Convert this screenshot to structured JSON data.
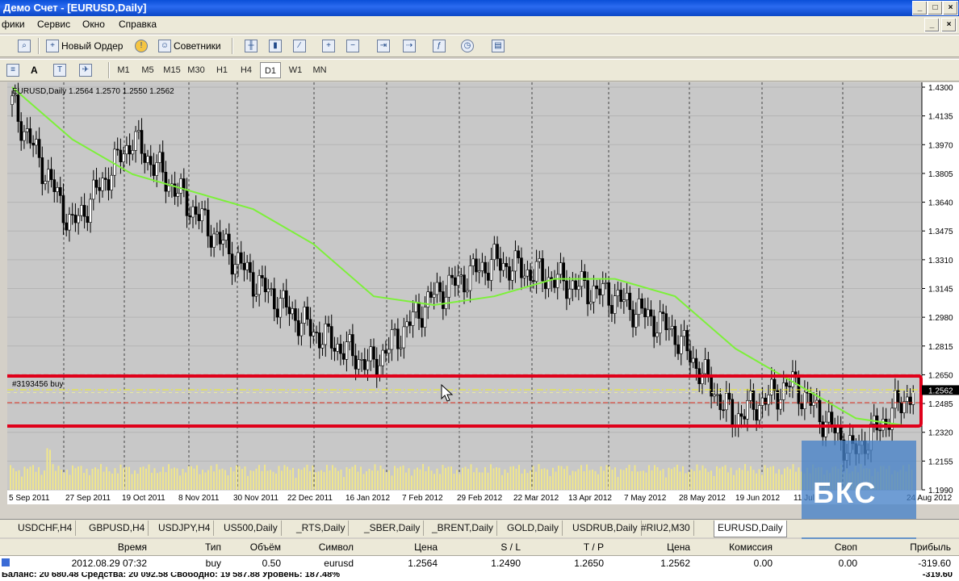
{
  "window": {
    "title": "Демо Счет - [EURUSD,Daily]"
  },
  "menu": [
    "фики",
    "Сервис",
    "Окно",
    "Справка"
  ],
  "toolbar": {
    "new_order": "Новый Ордер",
    "advisors": "Советники"
  },
  "timeframes": [
    "M1",
    "M5",
    "M15",
    "M30",
    "H1",
    "H4",
    "D1",
    "W1",
    "MN"
  ],
  "active_timeframe": "D1",
  "chart": {
    "info": "EURUSD,Daily  1.2564 1.2570 1.2550 1.2562",
    "order_label": "#3193456 buy",
    "price_labels": [
      "1.4300",
      "1.4135",
      "1.3970",
      "1.3805",
      "1.3640",
      "1.3475",
      "1.3310",
      "1.3145",
      "1.2980",
      "1.2815",
      "1.2650",
      "1.2485",
      "1.2320",
      "1.2155",
      "1.1990"
    ],
    "current_price": "1.2562",
    "date_labels": [
      "5 Sep 2011",
      "27 Sep 2011",
      "19 Oct 2011",
      "8 Nov 2011",
      "30 Nov 2011",
      "22 Dec 2011",
      "16 Jan 2012",
      "7 Feb 2012",
      "29 Feb 2012",
      "22 Mar 2012",
      "13 Apr 2012",
      "7 May 2012",
      "28 May 2012",
      "19 Jun 2012",
      "11 Jul",
      "24 Aug 2012"
    ],
    "colors": {
      "background": "#c8c8c8",
      "up_candle": "#ffffff",
      "moving_average": "#7df03a",
      "highlight_box": "#e0001a",
      "volume": "#f0e68c"
    }
  },
  "chart_data": {
    "type": "candlestick",
    "symbol": "EURUSD",
    "timeframe": "Daily",
    "last_bar": {
      "open": 1.2564,
      "high": 1.257,
      "low": 1.255,
      "close": 1.2562
    },
    "ylim": [
      1.199,
      1.43
    ],
    "x": [
      "5 Sep 2011",
      "27 Sep 2011",
      "19 Oct 2011",
      "8 Nov 2011",
      "30 Nov 2011",
      "22 Dec 2011",
      "16 Jan 2012",
      "7 Feb 2012",
      "29 Feb 2012",
      "22 Mar 2012",
      "13 Apr 2012",
      "7 May 2012",
      "28 May 2012",
      "19 Jun 2012",
      "11 Jul",
      "24 Aug 2012"
    ],
    "close": [
      1.42,
      1.35,
      1.4,
      1.36,
      1.32,
      1.29,
      1.27,
      1.31,
      1.33,
      1.32,
      1.31,
      1.29,
      1.24,
      1.26,
      1.22,
      1.256
    ],
    "moving_average": [
      1.43,
      1.4,
      1.38,
      1.37,
      1.36,
      1.34,
      1.31,
      1.305,
      1.31,
      1.32,
      1.32,
      1.31,
      1.28,
      1.26,
      1.24,
      1.235
    ]
  },
  "tabs": [
    "USDCHF,H4",
    "GBPUSD,H4",
    "USDJPY,H4",
    "US500,Daily",
    "_RTS,Daily",
    "_SBER,Daily",
    "_BRENT,Daily",
    "GOLD,Daily",
    "USDRUB,Daily",
    "#RIU2,M30",
    "EURUSD,Daily"
  ],
  "active_tab": "EURUSD,Daily",
  "terminal": {
    "headers": [
      "Время",
      "Тип",
      "Объём",
      "Символ",
      "Цена",
      "S / L",
      "T / P",
      "Цена",
      "Комиссия",
      "Своп",
      "Прибыль"
    ],
    "row": [
      "2012.08.29 07:32",
      "buy",
      "0.50",
      "eurusd",
      "1.2564",
      "1.2490",
      "1.2650",
      "1.2562",
      "0.00",
      "0.00",
      "-319.60"
    ],
    "balance": "Баланс: 20 680.48  Средства: 20 092.58  Свободно: 19 587.88  Уровень: 187.48%",
    "balance_right": "-319.60"
  },
  "watermark": "БКС"
}
